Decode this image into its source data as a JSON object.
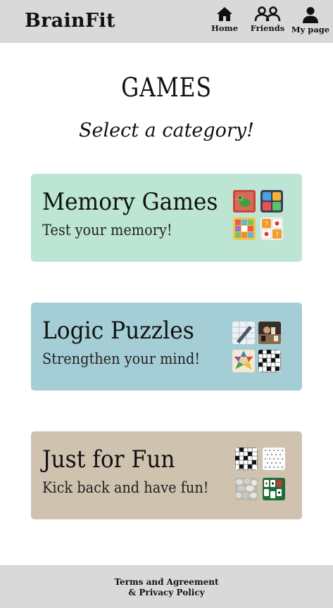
{
  "header": {
    "brand": "BrainFit",
    "nav": {
      "home": "Home",
      "friends": "Friends",
      "mypage": "My page"
    }
  },
  "main": {
    "title": "GAMES",
    "subtitle": "Select a category!",
    "categories": [
      {
        "title": "Memory Games",
        "subtitle": "Test your memory!",
        "color": "#bce5d4",
        "thumbnails": [
          "bird-card-icon",
          "tile-grid-icon",
          "memory-board-icon",
          "question-cards-icon"
        ]
      },
      {
        "title": "Logic Puzzles",
        "subtitle": "Strengthen your mind!",
        "color": "#a4cdd6",
        "thumbnails": [
          "pencil-paper-icon",
          "chess-photo-icon",
          "chinese-checkers-icon",
          "crossword-icon"
        ]
      },
      {
        "title": "Just for Fun",
        "subtitle": "Kick back and have fun!",
        "color": "#cfc2ae",
        "thumbnails": [
          "crossword-icon",
          "word-search-icon",
          "pebbles-icon",
          "solitaire-icon"
        ]
      }
    ]
  },
  "footer": {
    "terms": "Terms and Agreement",
    "privacy": "& Privacy Policy"
  }
}
